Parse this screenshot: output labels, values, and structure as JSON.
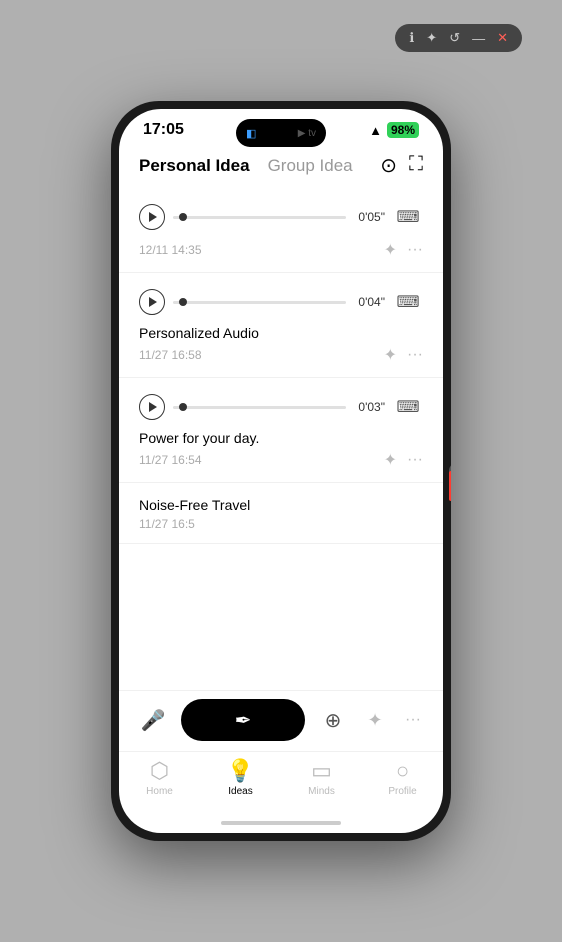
{
  "window": {
    "bar_icons": [
      "ℹ",
      "✦",
      "↺",
      "—",
      "✕"
    ]
  },
  "status_bar": {
    "time": "17:05",
    "dynamic_island_left": "◧",
    "dynamic_island_right": "▶tv",
    "wifi": "WiFi",
    "battery": "98%"
  },
  "tabs": {
    "personal_label": "Personal Idea",
    "group_label": "Group Idea",
    "active": "personal"
  },
  "header_icons": {
    "search": "🔍",
    "expand": "⛶"
  },
  "audio_items": [
    {
      "id": "item1",
      "duration": "0'05\"",
      "has_title": false,
      "title": "",
      "date": "12/11 14:35",
      "progress": 4
    },
    {
      "id": "item2",
      "duration": "0'04\"",
      "has_title": true,
      "title": "Personalized Audio",
      "date": "11/27 16:58",
      "progress": 4
    },
    {
      "id": "item3",
      "duration": "0'03\"",
      "has_title": true,
      "title": "Power for your day.",
      "date": "11/27 16:54",
      "progress": 4
    },
    {
      "id": "item4",
      "duration": "",
      "has_title": true,
      "title": "Noise-Free Travel",
      "date": "11/27 16:5",
      "progress": 0
    }
  ],
  "bottom_bar": {
    "mic_label": "mic",
    "record_label": "record",
    "speaker_label": "speaker",
    "add_label": "add",
    "more_label": "more"
  },
  "bottom_nav": {
    "items": [
      {
        "id": "home",
        "label": "Home",
        "icon": "⬡",
        "active": false
      },
      {
        "id": "ideas",
        "label": "Ideas",
        "icon": "💡",
        "active": true
      },
      {
        "id": "minds",
        "label": "Minds",
        "icon": "☐",
        "active": false
      },
      {
        "id": "profile",
        "label": "Profile",
        "icon": "○",
        "active": false
      }
    ]
  }
}
